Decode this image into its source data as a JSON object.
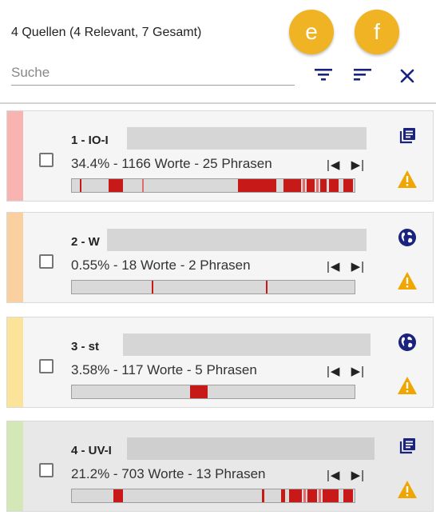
{
  "header": {
    "summary": "4 Quellen (4 Relevant, 7 Gesamt)",
    "search_placeholder": "Suche",
    "badge_e": "e",
    "badge_f": "f",
    "filter_icon": "filter-icon",
    "sort_icon": "sort-icon",
    "close_icon": "close-icon"
  },
  "colors": {
    "accent": "#1a237e",
    "badge": "#f0b323",
    "warning": "#f0a500",
    "match": "#c81919"
  },
  "sources": [
    {
      "title": "1 - IO-I",
      "stats": "34.4% - 1166 Worte - 25 Phrasen",
      "bar_color": "#f8b4b0",
      "type_icon": "document-stack-icon",
      "nav_prev": "|◀",
      "nav_next": "▶|"
    },
    {
      "title": "2 - W",
      "stats": "0.55% - 18 Worte - 2 Phrasen",
      "bar_color": "#fbd0a1",
      "type_icon": "globe-icon",
      "nav_prev": "|◀",
      "nav_next": "▶|"
    },
    {
      "title": "3 - st",
      "stats": "3.58% - 117 Worte - 5 Phrasen",
      "bar_color": "#fbe49a",
      "type_icon": "globe-icon",
      "nav_prev": "|◀",
      "nav_next": "▶|"
    },
    {
      "title": "4 - UV-I",
      "stats": "21.2% - 703 Worte - 13 Phrasen",
      "bar_color": "#d3e8b6",
      "type_icon": "document-stack-icon",
      "nav_prev": "|◀",
      "nav_next": "▶|"
    }
  ]
}
